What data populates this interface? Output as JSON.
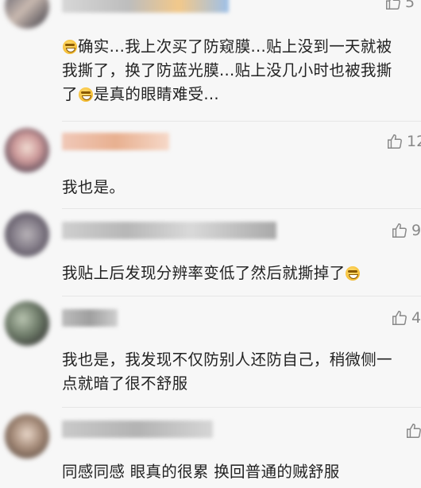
{
  "comments": [
    {
      "text_parts": [
        "",
        "确实...我上次买了防窥膜...贴上没到一天就被我撕了，换了防蓝光膜...贴上没几小时也被我撕了",
        "是真的眼睛难受..."
      ],
      "like_count": "5",
      "emoji_icon": "laughing-tears-emoji"
    },
    {
      "text": "我也是。",
      "like_count": "12"
    },
    {
      "text_parts": [
        "我贴上后发现分辨率变低了然后就撕掉了",
        ""
      ],
      "like_count": "9",
      "emoji_icon": "laughing-tears-emoji"
    },
    {
      "text": "我也是，我发现不仅防别人还防自己，稍微侧一点就暗了很不舒服",
      "like_count": "4"
    },
    {
      "text": "同感同感 眼真的很累 换回普通的贼舒服",
      "like_count": ""
    }
  ],
  "icons": {
    "like": "thumbs-up-icon"
  },
  "colors": {
    "background": "#f7f7f7",
    "text": "#222222",
    "meta": "#888888"
  }
}
